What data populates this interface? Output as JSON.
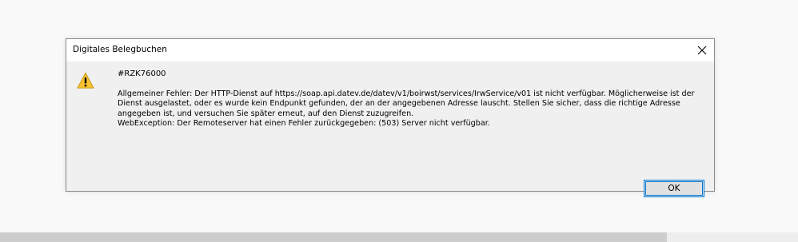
{
  "dialog": {
    "title": "Digitales Belegbuchen",
    "code": "#RZK76000",
    "message_lines": [
      "Allgemeiner Fehler: Der HTTP-Dienst auf https://soap.api.datev.de/datev/v1/boirwst/services/IrwService/v01 ist nicht verfügbar. Möglicherweise ist der Dienst ausgelastet, oder es wurde kein Endpunkt gefunden, der an der angegebenen Adresse lauscht. Stellen Sie sicher, dass die richtige Adresse angegeben ist, und versuchen Sie später erneut, auf den Dienst zuzugreifen.",
      "WebException: Der Remoteserver hat einen Fehler zurückgegeben: (503) Server nicht verfügbar."
    ],
    "ok_label": "OK",
    "icons": {
      "close": "close-icon",
      "warning": "warning-icon"
    }
  }
}
